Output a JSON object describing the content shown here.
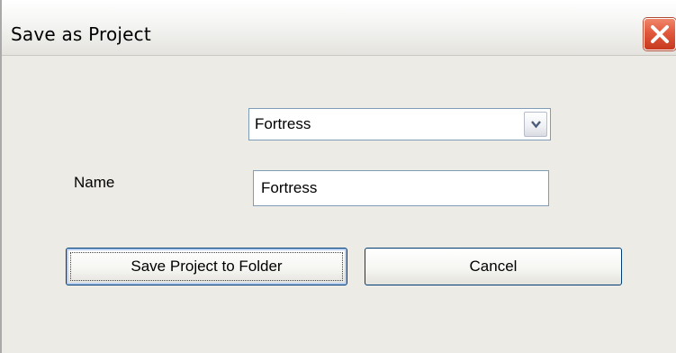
{
  "window": {
    "title": "Save as Project",
    "close_icon": "close-icon"
  },
  "form": {
    "project_select": {
      "selected": "Fortress",
      "arrow_icon": "chevron-down-icon"
    },
    "name_label": "Name",
    "name_value": "Fortress"
  },
  "buttons": {
    "save_label": "Save Project to Folder",
    "cancel_label": "Cancel"
  },
  "colors": {
    "window_bg": "#ecebe6",
    "close_red": "#e1593c",
    "field_border": "#7f9db9",
    "button_border": "#003c74"
  }
}
